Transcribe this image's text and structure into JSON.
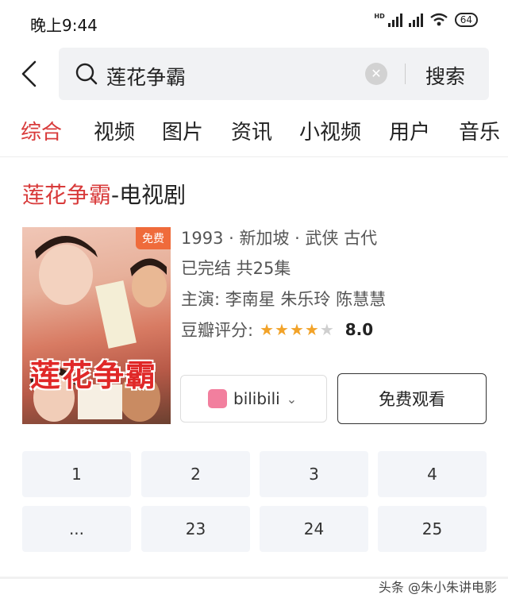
{
  "status_bar": {
    "time": "晚上9:44",
    "battery": "64",
    "network_label": "HD"
  },
  "search": {
    "query": "莲花争霸",
    "button_label": "搜索"
  },
  "tabs": [
    {
      "label": "综合",
      "active": true
    },
    {
      "label": "视频"
    },
    {
      "label": "图片"
    },
    {
      "label": "资讯"
    },
    {
      "label": "小视频"
    },
    {
      "label": "用户"
    },
    {
      "label": "音乐"
    }
  ],
  "result": {
    "title_highlight": "莲花争霸",
    "title_suffix": "-电视剧",
    "poster": {
      "badge": "免费",
      "title": "莲花争霸"
    },
    "meta_line1": "1993 · 新加坡 · 武侠 古代",
    "meta_line2": "已完结 共25集",
    "meta_line3": "主演: 李南星 朱乐玲 陈慧慧",
    "rating_label": "豆瓣评分:",
    "rating_stars": 4,
    "rating_score": "8.0",
    "source_label": "bilibili",
    "watch_label": "免费观看"
  },
  "episodes": [
    "1",
    "2",
    "3",
    "4",
    "...",
    "23",
    "24",
    "25"
  ],
  "watermark": "头条 @朱小朱讲电影",
  "colors": {
    "accent": "#d83a3a",
    "star": "#f2a329",
    "free_tag": "#ef6b3b"
  }
}
